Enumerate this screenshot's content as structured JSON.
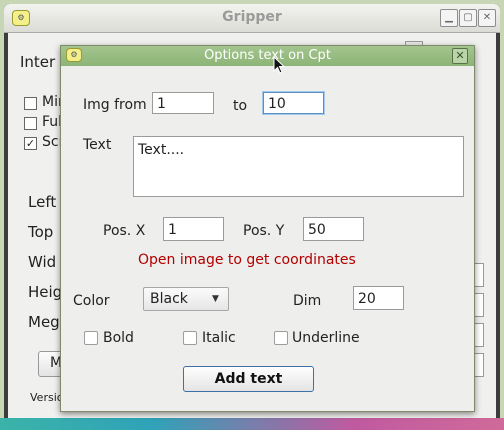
{
  "main_window": {
    "title": "Gripper",
    "app_icon": "app-gear-icon",
    "controls": {
      "minimize": "▁",
      "maximize": "▢",
      "close": "✕"
    },
    "labels": {
      "inter": "Inter",
      "opt1": "Mir",
      "opt2": "Ful",
      "opt3": "Scr",
      "left": "Left",
      "top": "Top",
      "width": "Wid",
      "height": "Heig",
      "mega": "Meg",
      "button_partial": "M",
      "version": "Versio"
    },
    "checkbox_states": {
      "opt1": false,
      "opt2": false,
      "opt3": true
    }
  },
  "dialog": {
    "title": "Options text on Cpt",
    "close_glyph": "✕",
    "img_from_label": "Img from",
    "img_from_value": "1",
    "to_label": "to",
    "to_value": "10",
    "text_label": "Text",
    "text_value": "Text....",
    "pos_x_label": "Pos. X",
    "pos_x_value": "1",
    "pos_y_label": "Pos. Y",
    "pos_y_value": "50",
    "hint": "Open image to get coordinates",
    "color_label": "Color",
    "color_value": "Black",
    "dim_label": "Dim",
    "dim_value": "20",
    "bold_label": "Bold",
    "italic_label": "Italic",
    "underline_label": "Underline",
    "bold_checked": false,
    "italic_checked": false,
    "underline_checked": false,
    "add_button_label": "Add text"
  },
  "colors": {
    "dialog_title_bar": "#8db477",
    "hint_text": "#b30000",
    "focus_border": "#5a8fc5"
  }
}
